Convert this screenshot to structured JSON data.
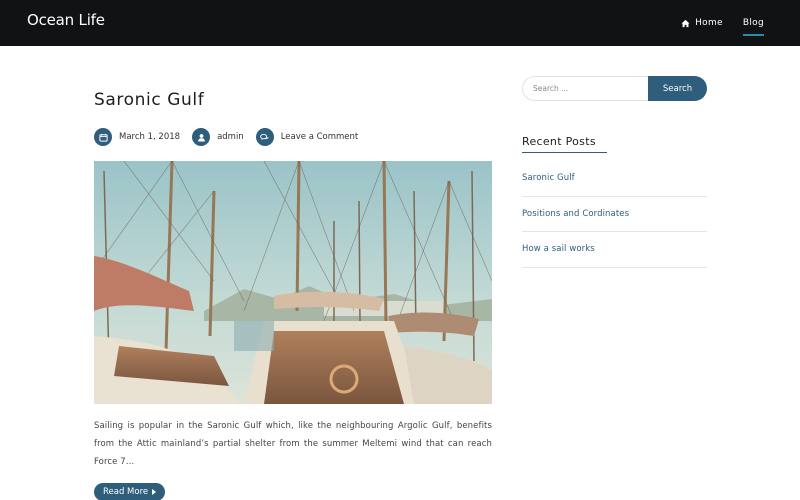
{
  "site": {
    "brand": "Ocean Life"
  },
  "nav": {
    "items": [
      {
        "label": "Home",
        "icon": "home-icon",
        "active": false
      },
      {
        "label": "Blog",
        "active": true
      }
    ]
  },
  "post": {
    "title": "Saronic Gulf",
    "meta": {
      "date": "March 1, 2018",
      "author": "admin",
      "comments": "Leave a Comment"
    },
    "image_alt": "Sailing boats moored in a harbour",
    "excerpt": "Sailing is popular in the Saronic Gulf which, like the neighbouring Argolic Gulf, benefits from the Attic mainland’s partial shelter from the summer Meltemi wind that can reach Force 7…",
    "read_more": "Read More"
  },
  "sidebar": {
    "search": {
      "placeholder": "Search ...",
      "button": "Search"
    },
    "recent": {
      "title": "Recent Posts",
      "items": [
        "Saronic Gulf",
        "Positions and Cordinates",
        "How a sail works"
      ]
    }
  },
  "colors": {
    "accent": "#2f5e7c",
    "header_bg": "#111214",
    "nav_underline": "#2b8ab0"
  }
}
